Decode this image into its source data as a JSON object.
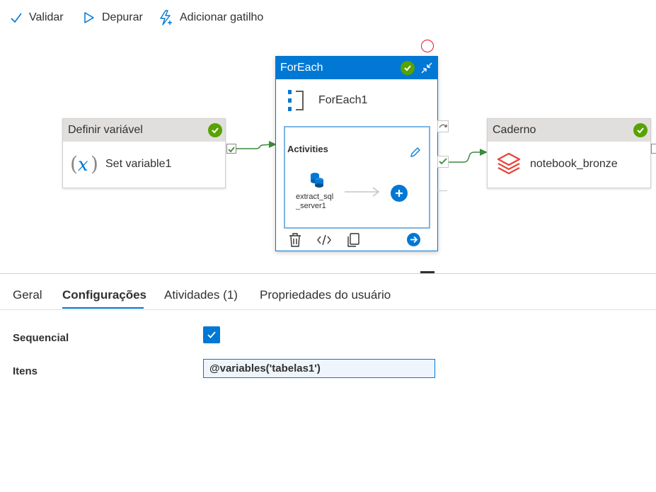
{
  "toolbar": {
    "validate": "Validar",
    "debug": "Depurar",
    "add_trigger": "Adicionar gatilho"
  },
  "canvas": {
    "set_variable": {
      "type": "Definir variável",
      "name": "Set variable1"
    },
    "foreach": {
      "type": "ForEach",
      "name": "ForEach1",
      "inner_title": "Activities",
      "inner_activity": [
        "extract_sql",
        "_server1"
      ]
    },
    "notebook": {
      "type": "Caderno",
      "name": "notebook_bronze"
    }
  },
  "tabs": [
    {
      "label": "Geral",
      "active": false
    },
    {
      "label": "Configurações",
      "active": true
    },
    {
      "label": "Atividades (1)",
      "active": false
    },
    {
      "label": "Propriedades do usuário",
      "active": false
    }
  ],
  "settings": {
    "sequential": {
      "label": "Sequencial",
      "checked": true
    },
    "items": {
      "label": "Itens",
      "value": "@variables('tabelas1')"
    }
  },
  "colors": {
    "accent": "#0078d4",
    "success": "#57a300",
    "connector": "#3b8a3e",
    "databricks": "#e8473b"
  },
  "icons": [
    "checkmark-icon",
    "play-icon",
    "trigger-icon",
    "variable-icon",
    "foreach-icon",
    "notebook-icon",
    "delete-icon",
    "code-icon",
    "copy-icon",
    "go-icon",
    "edit-icon",
    "sql-icon",
    "add-icon",
    "collapse-icon"
  ]
}
